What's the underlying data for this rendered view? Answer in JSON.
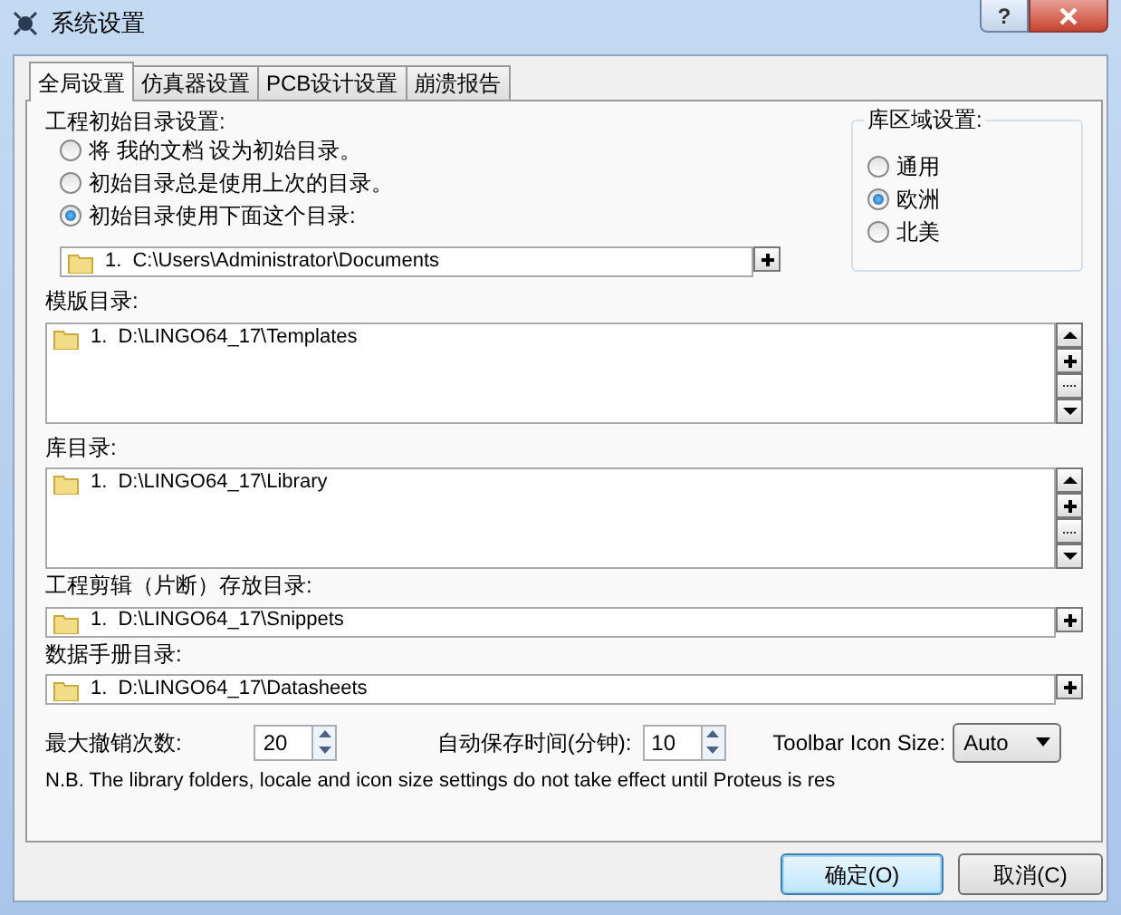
{
  "window": {
    "title": "系统设置",
    "help_button": "?"
  },
  "tabs": [
    {
      "label": "全局设置",
      "selected": true
    },
    {
      "label": "仿真器设置",
      "selected": false
    },
    {
      "label": "PCB设计设置",
      "selected": false
    },
    {
      "label": "崩溃报告",
      "selected": false
    }
  ],
  "start_dir": {
    "label": "工程初始目录设置:",
    "options": [
      {
        "label": "将 我的文档 设为初始目录。",
        "selected": false
      },
      {
        "label": "初始目录总是使用上次的目录。",
        "selected": false
      },
      {
        "label": "初始目录使用下面这个目录:",
        "selected": true
      }
    ],
    "entry": {
      "index": "1.",
      "path": "C:\\Users\\Administrator\\Documents"
    }
  },
  "region": {
    "label": "库区域设置:",
    "options": [
      {
        "label": "通用",
        "selected": false
      },
      {
        "label": "欧洲",
        "selected": true
      },
      {
        "label": "北美",
        "selected": false
      }
    ]
  },
  "dirs": [
    {
      "label": "模版目录:",
      "kind": "list",
      "entries": [
        {
          "index": "1.",
          "path": "D:\\LINGO64_17\\Templates"
        }
      ]
    },
    {
      "label": "库目录:",
      "kind": "list",
      "entries": [
        {
          "index": "1.",
          "path": "D:\\LINGO64_17\\Library"
        }
      ]
    },
    {
      "label": "工程剪辑（片断）存放目录:",
      "kind": "single",
      "entries": [
        {
          "index": "1.",
          "path": "D:\\LINGO64_17\\Snippets"
        }
      ]
    },
    {
      "label": "数据手册目录:",
      "kind": "single",
      "entries": [
        {
          "index": "1.",
          "path": "D:\\LINGO64_17\\Datasheets"
        }
      ]
    }
  ],
  "undo": {
    "label": "最大撤销次数:",
    "value": "20"
  },
  "autosave": {
    "label": "自动保存时间(分钟):",
    "value": "10"
  },
  "toolbar_icon_size": {
    "label": "Toolbar Icon Size:",
    "value": "Auto"
  },
  "note": "N.B. The library folders, locale and icon size settings do not take effect until Proteus is res",
  "buttons": [
    {
      "label": "确定(O)",
      "default": true
    },
    {
      "label": "取消(C)",
      "default": false
    }
  ]
}
